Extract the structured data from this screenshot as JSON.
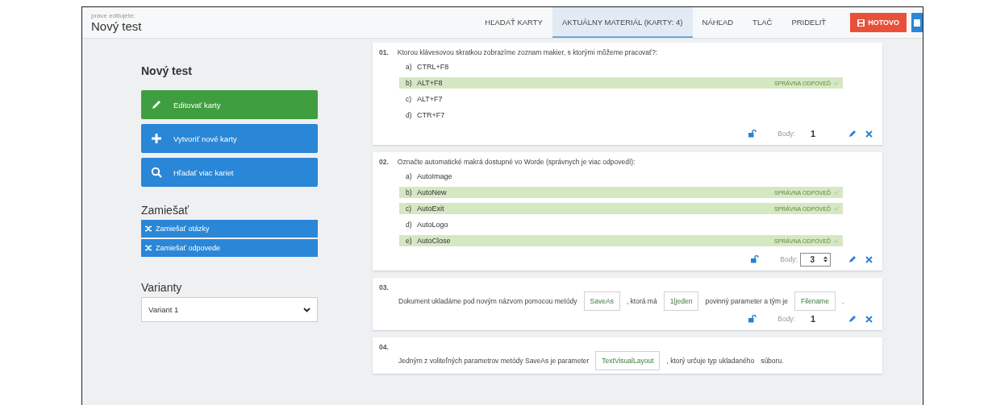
{
  "header": {
    "caption": "práve editujete:",
    "title": "Nový test",
    "tabs": [
      {
        "label": "HĽADAŤ KARTY",
        "selected": false
      },
      {
        "label": "AKTUÁLNY MATERIÁL (KARTY: 4)",
        "selected": true
      },
      {
        "label": "NÁHĽAD",
        "selected": false
      },
      {
        "label": "TLAČ",
        "selected": false
      },
      {
        "label": "PRIDELIŤ",
        "selected": false
      }
    ],
    "done_button": "HOTOVO"
  },
  "sidebar": {
    "title": "Nový test",
    "actions": [
      {
        "label": "Editovať karty",
        "kind": "edit"
      },
      {
        "label": "Vytvoriť nové karty",
        "kind": "create"
      },
      {
        "label": "Hľadať viac kariet",
        "kind": "search"
      }
    ],
    "shuffle_title": "Zamiešať",
    "shuffle_buttons": [
      "Zamiešať otázky",
      "Zamiešať odpovede"
    ],
    "variants_title": "Varianty",
    "variant": "Variant 1"
  },
  "questions": [
    {
      "number": "01.",
      "kind": "choice",
      "text": "Ktorou klávesovou skratkou zobrazíme zoznam makier, s ktorými môžeme pracovať?:",
      "options": [
        {
          "letter": "a)",
          "text": "CTRL+F8",
          "correct": false
        },
        {
          "letter": "b)",
          "text": "ALT+F8",
          "correct": true,
          "badge": "SPRÁVNA ODPOVEĎ"
        },
        {
          "letter": "c)",
          "text": "ALT+F7",
          "correct": false
        },
        {
          "letter": "d)",
          "text": "CTR+F7",
          "correct": false
        }
      ],
      "points_label": "Body:",
      "points": "1",
      "points_editing": false
    },
    {
      "number": "02.",
      "kind": "choice",
      "text": "Označte automatické makrá dostupné vo Worde (správnych je viac odpovedí):",
      "options": [
        {
          "letter": "a)",
          "text": "AutoImage",
          "correct": false
        },
        {
          "letter": "b)",
          "text": "AutoNew",
          "correct": true,
          "badge": "SPRÁVNA ODPOVEĎ"
        },
        {
          "letter": "c)",
          "text": "AutoExit",
          "correct": true,
          "badge": "SPRÁVNA ODPOVEĎ"
        },
        {
          "letter": "d)",
          "text": "AutoLogo",
          "correct": false
        },
        {
          "letter": "e)",
          "text": "AutoClose",
          "correct": true,
          "badge": "SPRÁVNA ODPOVEĎ"
        }
      ],
      "points_label": "Body:",
      "points": "3",
      "points_editing": true
    },
    {
      "number": "03.",
      "kind": "cloze",
      "segments": [
        {
          "kind": "text",
          "text": "Dokument ukladáme pod novým názvom pomocou metódy"
        },
        {
          "kind": "field",
          "text": "SaveAs"
        },
        {
          "kind": "text",
          "text": ", ktorá má"
        },
        {
          "kind": "field",
          "text": "1|jeden"
        },
        {
          "kind": "text",
          "text": "povinný parameter a tým je"
        },
        {
          "kind": "field",
          "text": "Filename"
        },
        {
          "kind": "text",
          "text": "."
        }
      ],
      "points_label": "Body:",
      "points": "1",
      "points_editing": false
    },
    {
      "number": "04.",
      "kind": "cloze",
      "segments": [
        {
          "kind": "text",
          "text": "Jedným z voliteľných parametrov metódy SaveAs je parameter"
        },
        {
          "kind": "field",
          "text": "TextVisualLayout"
        },
        {
          "kind": "text",
          "text": ", ktorý určuje typ ukladaného"
        },
        {
          "kind": "text",
          "text": "súboru."
        }
      ]
    }
  ]
}
